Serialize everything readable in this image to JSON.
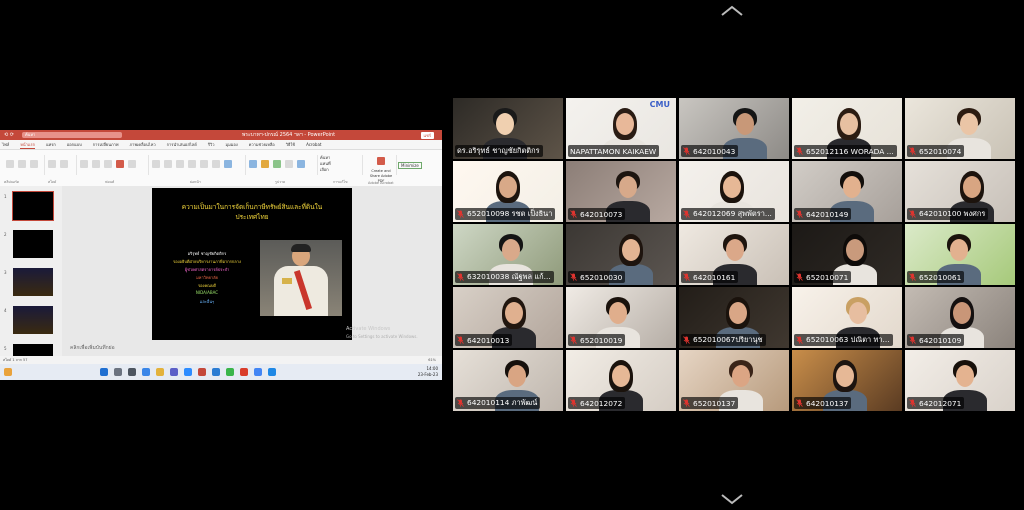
{
  "navigation": {
    "up_icon": "chevron-up-icon",
    "down_icon": "chevron-down-icon"
  },
  "shared_screen": {
    "powerpoint": {
      "file_title": "พระบาทฯ-ปกรณ์ 2564 ฯลฯ - PowerPoint",
      "search_placeholder": "ค้นหา",
      "share_button": "แชร์",
      "tabs": [
        "ไฟล์",
        "หน้าแรก",
        "แทรก",
        "ออกแบบ",
        "การเปลี่ยนภาพ",
        "ภาพเคลื่อนไหว",
        "การนำเสนอสไลด์",
        "รีวิว",
        "มุมมอง",
        "ความช่วยเหลือ",
        "วิธีใช้",
        "Acrobat"
      ],
      "active_tab": "หน้าแรก",
      "slide_numbers": [
        "1",
        "2",
        "3",
        "4",
        "5"
      ],
      "notes_placeholder": "คลิกเพื่อเพิ่มบันทึกย่อ",
      "watermark_line1": "Activate Windows",
      "watermark_line2": "Go to Settings to activate Windows.",
      "status_text": "สไลด์ 1 จาก 57",
      "zoom": "61%",
      "ribbon_labels": {
        "clipboard": "คลิปบอร์ด",
        "slides": "สไลด์",
        "font": "ฟอนต์",
        "paragraph": "ย่อหน้า",
        "drawing": "รูปวาด",
        "editing": "การแก้ไข",
        "acrobat": "Adobe Acrobat",
        "create_share": "Create and Share Adobe PDF",
        "find": "ค้นหา",
        "replace": "แทนที่",
        "select": "เลือก",
        "minimize": "Minimize"
      }
    },
    "slide": {
      "title": "ความเป็นมาในการจัดเก็บภาษีทรัพย์สินและที่ดินในประเทศไทย",
      "presenter_lines": [
        {
          "text": "อริรุทธ์ ชาญชัยกิตติกร",
          "color": "#ffffff"
        },
        {
          "text": "รองอธิบดีฝ่ายบริหารงานภาษีอากรกลาง",
          "color": "#f5d83c"
        },
        {
          "text": "ผู้ช่วยศาสตราจารย์ประจำ",
          "color": "#ff6bd6"
        },
        {
          "text": "มหาวิทยาลัย",
          "color": "#f56c4a"
        },
        {
          "text": "รองคณบดี",
          "color": "#f5d83c"
        },
        {
          "text": "NIDA/ABAC",
          "color": "#9be36b"
        },
        {
          "text": "และอื่นๆ",
          "color": "#6bb6ff"
        }
      ]
    },
    "taskbar": {
      "time": "14:00",
      "date": "23-Feb-23"
    }
  },
  "participants": [
    {
      "name": "ดร.อริรุทธ์ ชาญชัยกิตติกร",
      "muted": false,
      "active": true
    },
    {
      "name": "NAPATTAMON KAIKAEW",
      "muted": false,
      "active": false
    },
    {
      "name": "642010043",
      "muted": true,
      "active": false
    },
    {
      "name": "652012116 WORADA ...",
      "muted": true,
      "active": false
    },
    {
      "name": "652010074",
      "muted": true,
      "active": false
    },
    {
      "name": "652010098 รชต เป็งธินา",
      "muted": true,
      "active": false
    },
    {
      "name": "642010073",
      "muted": true,
      "active": false
    },
    {
      "name": "642012069 สุพพัตรา...",
      "muted": true,
      "active": false
    },
    {
      "name": "642010149",
      "muted": true,
      "active": false
    },
    {
      "name": "642010100 พงศกร",
      "muted": true,
      "active": false
    },
    {
      "name": "632010038 ณัฐพล แก้...",
      "muted": true,
      "active": false
    },
    {
      "name": "652010030",
      "muted": true,
      "active": false
    },
    {
      "name": "642010161",
      "muted": true,
      "active": false
    },
    {
      "name": "652010071",
      "muted": true,
      "active": false
    },
    {
      "name": "652010061",
      "muted": true,
      "active": false
    },
    {
      "name": "642010013",
      "muted": true,
      "active": false
    },
    {
      "name": "652010019",
      "muted": true,
      "active": false
    },
    {
      "name": "652010067ปริยานุช",
      "muted": true,
      "active": false
    },
    {
      "name": "652010063 ปณิตา ทา...",
      "muted": true,
      "active": false
    },
    {
      "name": "642010109",
      "muted": true,
      "active": false
    },
    {
      "name": "642010114 ภาพัฒน์",
      "muted": true,
      "active": false
    },
    {
      "name": "642012072",
      "muted": true,
      "active": false
    },
    {
      "name": "652010137",
      "muted": true,
      "active": false
    },
    {
      "name": "642010137",
      "muted": true,
      "active": false
    },
    {
      "name": "642012071",
      "muted": true,
      "active": false
    }
  ],
  "branding": {
    "cmu_logo_text": "CMU"
  },
  "colors": {
    "active_speaker_border": "#36c24b",
    "muted_icon": "#e0342f",
    "powerpoint_accent": "#c4483a"
  }
}
